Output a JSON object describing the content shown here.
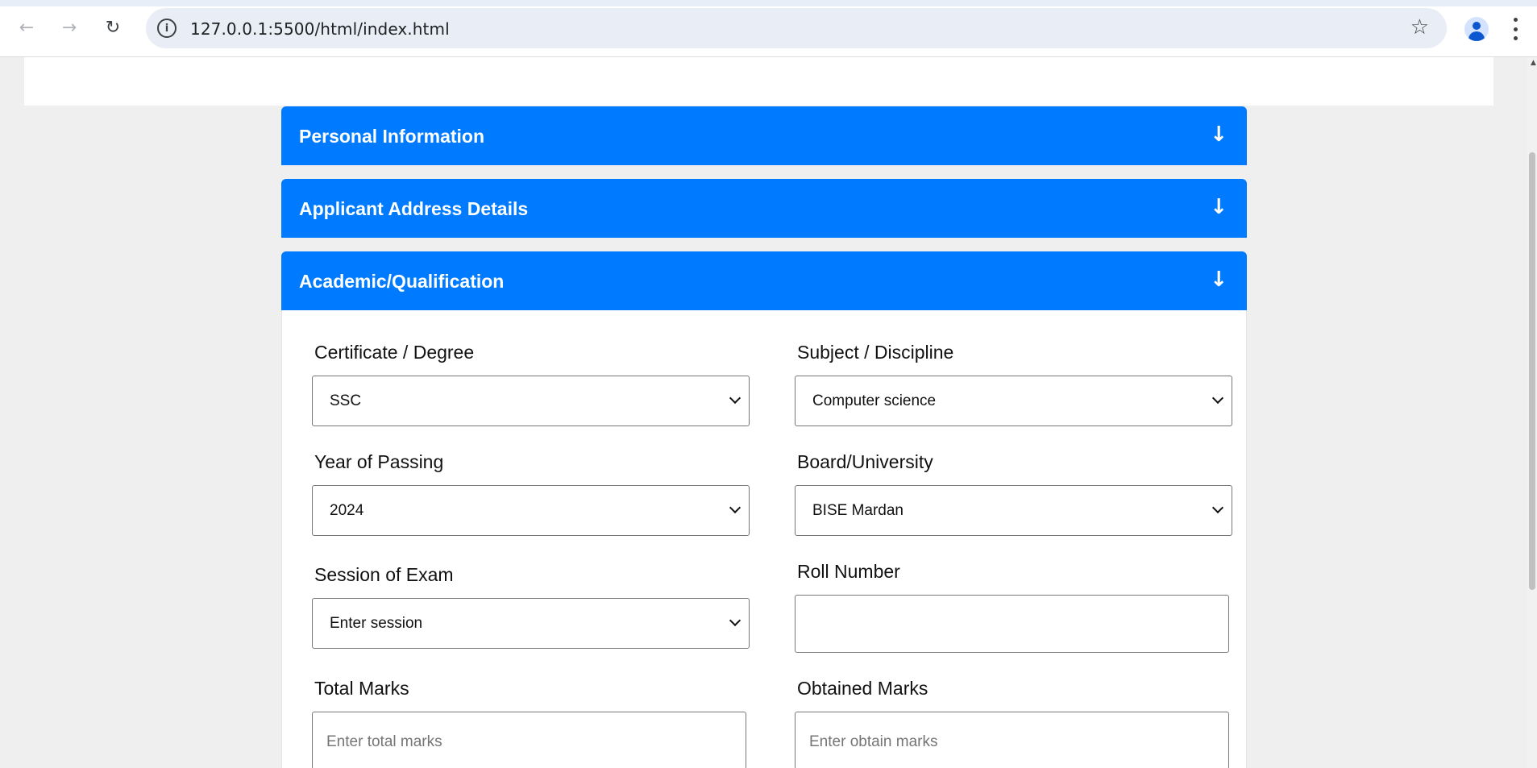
{
  "browser": {
    "url": "127.0.0.1:5500/html/index.html"
  },
  "accordions": [
    {
      "title": "Personal Information"
    },
    {
      "title": "Applicant Address Details"
    },
    {
      "title": "Academic/Qualification"
    }
  ],
  "icons": {
    "back": "arrow-left-icon",
    "forward": "arrow-right-icon",
    "reload": "reload-icon",
    "info": "info-icon",
    "star": "star-icon",
    "profile": "profile-icon",
    "menu": "menu-icon",
    "expand": "arrow-down-icon"
  },
  "form": {
    "certificate": {
      "label": "Certificate / Degree",
      "value": "SSC"
    },
    "subject": {
      "label": "Subject / Discipline",
      "value": "Computer science"
    },
    "year": {
      "label": "Year of Passing",
      "value": "2024"
    },
    "board": {
      "label": "Board/University",
      "value": "BISE Mardan"
    },
    "session": {
      "label": "Session of Exam",
      "value": "Enter session"
    },
    "roll": {
      "label": "Roll Number",
      "value": ""
    },
    "total": {
      "label": "Total Marks",
      "placeholder": "Enter total marks"
    },
    "obtained": {
      "label": "Obtained Marks",
      "placeholder": "Enter obtain marks"
    }
  },
  "colors": {
    "accordion": "#007bff",
    "background": "#efefef"
  }
}
